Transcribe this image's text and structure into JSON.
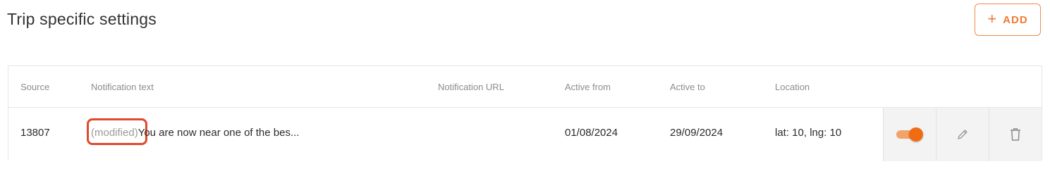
{
  "header": {
    "title": "Trip specific settings",
    "add_label": "ADD",
    "add_icon": "plus-icon"
  },
  "table": {
    "columns": [
      "Source",
      "Notification text",
      "Notification URL",
      "Active from",
      "Active to",
      "Location"
    ],
    "rows": [
      {
        "source": "13807",
        "modified_tag": "(modified)",
        "notification_text": "You are now near one of the bes...",
        "notification_url": "",
        "active_from": "01/08/2024",
        "active_to": "29/09/2024",
        "location": "lat: 10, lng: 10",
        "enabled": true,
        "actions": [
          "toggle",
          "pencil-icon",
          "trash-icon"
        ]
      }
    ]
  },
  "colors": {
    "accent": "#ef6c12",
    "accent_light": "#f2a36b",
    "highlight_border": "#e0492c"
  }
}
